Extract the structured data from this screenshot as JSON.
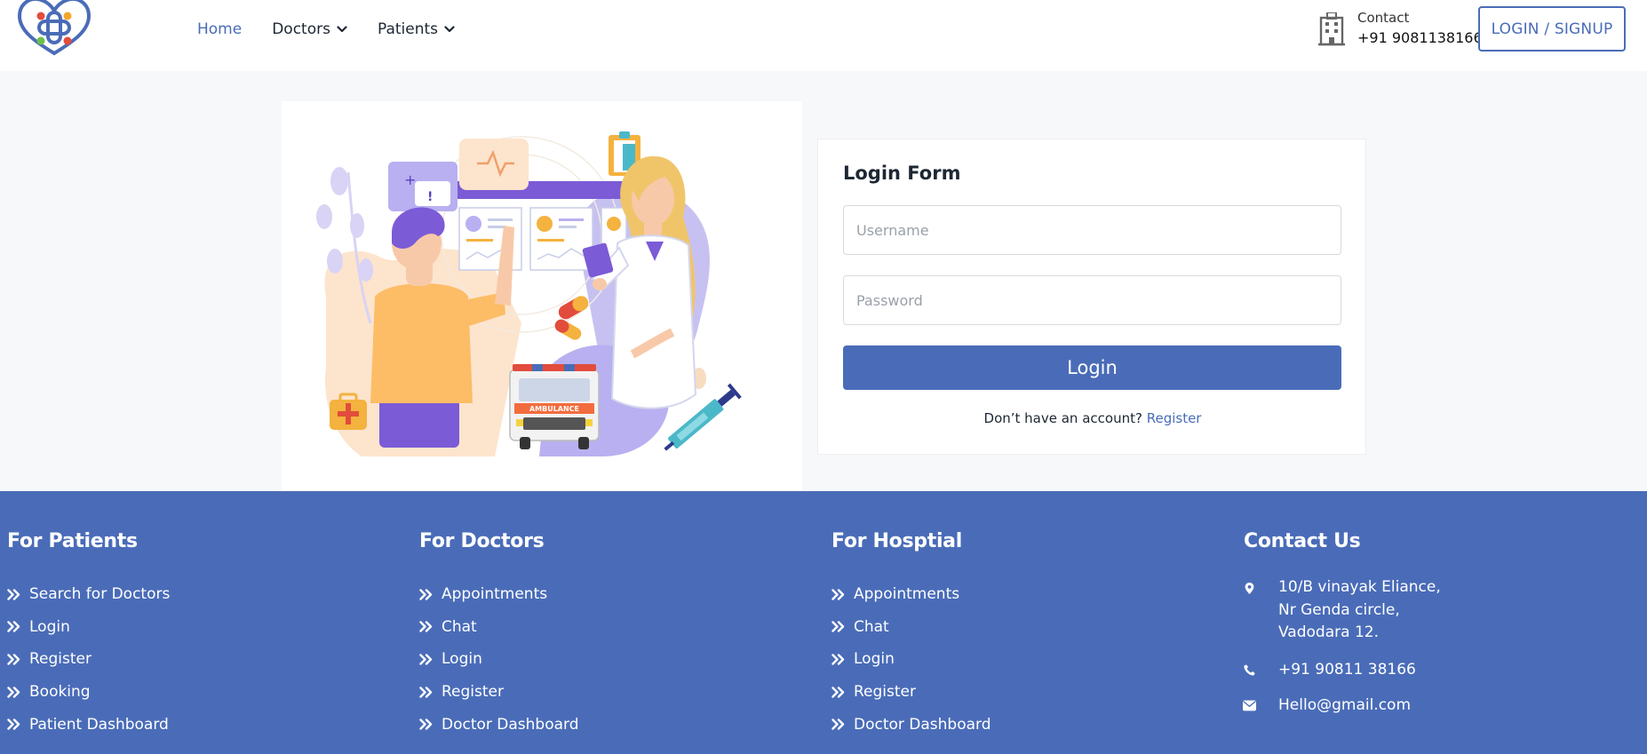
{
  "header": {
    "nav": [
      {
        "label": "Home",
        "active": true,
        "dropdown": false
      },
      {
        "label": "Doctors",
        "active": false,
        "dropdown": true
      },
      {
        "label": "Patients",
        "active": false,
        "dropdown": true
      }
    ],
    "contact_label": "Contact",
    "contact_phone": "+91 9081138166",
    "auth_button": "LOGIN / SIGNUP"
  },
  "login_form": {
    "title": "Login Form",
    "username_placeholder": "Username",
    "password_placeholder": "Password",
    "submit_label": "Login",
    "register_prompt": "Don’t have an account?",
    "register_link": "Register"
  },
  "illustration": {
    "ambulance_text": "AMBULANCE"
  },
  "footer": {
    "patients": {
      "title": "For Patients",
      "links": [
        "Search for Doctors",
        "Login",
        "Register",
        "Booking",
        "Patient Dashboard"
      ]
    },
    "doctors": {
      "title": "For Doctors",
      "links": [
        "Appointments",
        "Chat",
        "Login",
        "Register",
        "Doctor Dashboard"
      ]
    },
    "hospital": {
      "title": "For Hosptial",
      "links": [
        "Appointments",
        "Chat",
        "Login",
        "Register",
        "Doctor Dashboard"
      ]
    },
    "contact": {
      "title": "Contact Us",
      "address_lines": [
        "10/B vinayak Eliance,",
        "Nr Genda circle,",
        "Vadodara 12."
      ],
      "phone": "+91 90811 38166",
      "email": "Hello@gmail.com"
    }
  },
  "icons": {
    "logo": "heart-cross-logo",
    "contact": "hospital-building-icon",
    "footer_bullet": "double-chevron-right-icon",
    "address": "map-pin-icon",
    "phone": "phone-icon",
    "email": "envelope-icon"
  },
  "colors": {
    "brand_blue": "#4a6cb8",
    "page_bg": "#f7f8fa",
    "text_dark": "#1d2733"
  }
}
